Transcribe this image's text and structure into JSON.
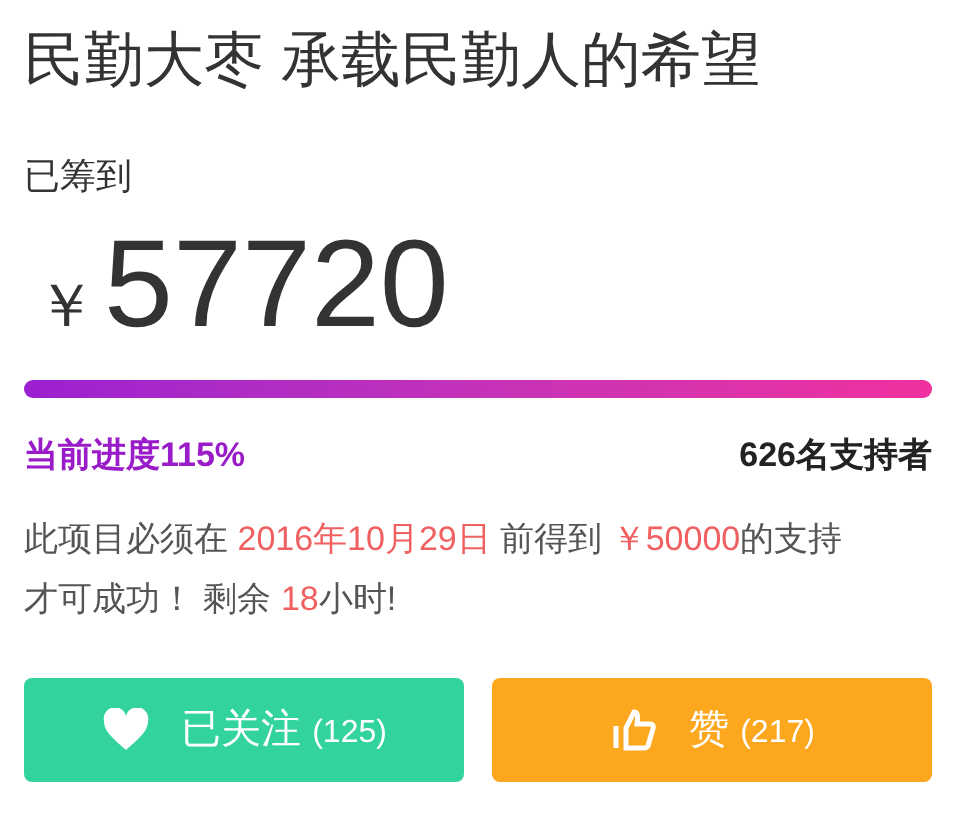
{
  "title": "民勤大枣 承载民勤人的希望",
  "raised_label": "已筹到",
  "currency": "￥",
  "amount": "57720",
  "progress": {
    "level": 1,
    "label": "当前进度115%",
    "supporters": "626名支持者"
  },
  "notice": [
    {
      "text": "此项目必须在 ",
      "highlight": false
    },
    {
      "text": "2016年10月29日",
      "highlight": true
    },
    {
      "text": " 前得到 ",
      "highlight": false
    },
    {
      "text": "￥50000",
      "highlight": true
    },
    {
      "text": "的支持才可成功！ 剩余 ",
      "highlight": false
    },
    {
      "text": "18",
      "highlight": true
    },
    {
      "text": "小时!",
      "highlight": false
    }
  ],
  "buttons": [
    {
      "kind": "follow",
      "label": "已关注",
      "count": "(125)"
    },
    {
      "kind": "like",
      "label": "赞",
      "count": "(217)"
    }
  ]
}
